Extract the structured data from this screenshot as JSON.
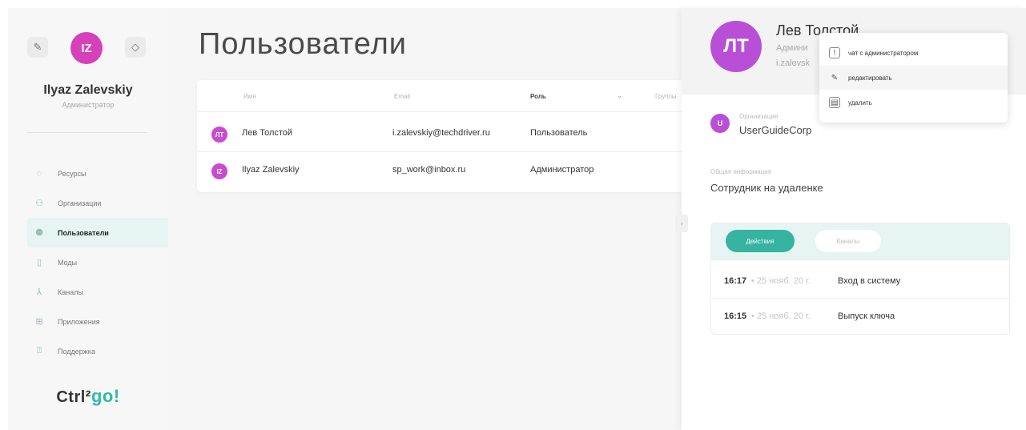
{
  "sidebar": {
    "avatar_initials": "IZ",
    "user_name": "Ilyaz Zalevskiy",
    "user_role": "Администратор",
    "nav": [
      {
        "label": "Ресурсы",
        "icon": "circle-dashed-icon"
      },
      {
        "label": "Организации",
        "icon": "org-tree-icon"
      },
      {
        "label": "Пользователи",
        "icon": "users-icon"
      },
      {
        "label": "Моды",
        "icon": "document-icon"
      },
      {
        "label": "Каналы",
        "icon": "channels-icon"
      },
      {
        "label": "Приложения",
        "icon": "apps-grid-icon"
      },
      {
        "label": "Поддержка",
        "icon": "support-icon"
      }
    ],
    "logo_text": "Ctrl²",
    "logo_accent": "go!"
  },
  "main": {
    "title": "Пользователи",
    "columns": {
      "name": "Имя",
      "email": "Email",
      "role": "Роль",
      "groups": "Группы"
    },
    "rows": [
      {
        "initials": "ЛТ",
        "name": "Лев Толстой",
        "email": "i.zalevskiy@techdriver.ru",
        "role": "Пользователь"
      },
      {
        "initials": "IZ",
        "name": "Ilyaz Zalevskiy",
        "email": "sp_work@inbox.ru",
        "role": "Администратор"
      }
    ]
  },
  "panel": {
    "avatar_initials": "ЛТ",
    "name": "Лев Толстой",
    "role": "Админи",
    "email": "i.zalevsk",
    "org_initial": "U",
    "org_label": "Организация",
    "org_value": "UserGuideCorp",
    "general_label": "Общая информация",
    "general_value": "Сотрудник на удаленке",
    "tabs": [
      "Действия",
      "Каналы"
    ],
    "log": [
      {
        "time": "16:17",
        "date": "• 25 нояб. 20 г.",
        "event": "Вход в систему"
      },
      {
        "time": "16:15",
        "date": "• 25 нояб. 20 г.",
        "event": "Выпуск ключа"
      }
    ]
  },
  "menu": {
    "items": [
      {
        "label": "чат с администратором",
        "icon": "chat-icon"
      },
      {
        "label": "редактировать",
        "icon": "pencil-icon"
      },
      {
        "label": "удалить",
        "icon": "trash-icon"
      }
    ]
  },
  "colors": {
    "accent": "#36b3a1",
    "avatar": "#c84bd0"
  }
}
